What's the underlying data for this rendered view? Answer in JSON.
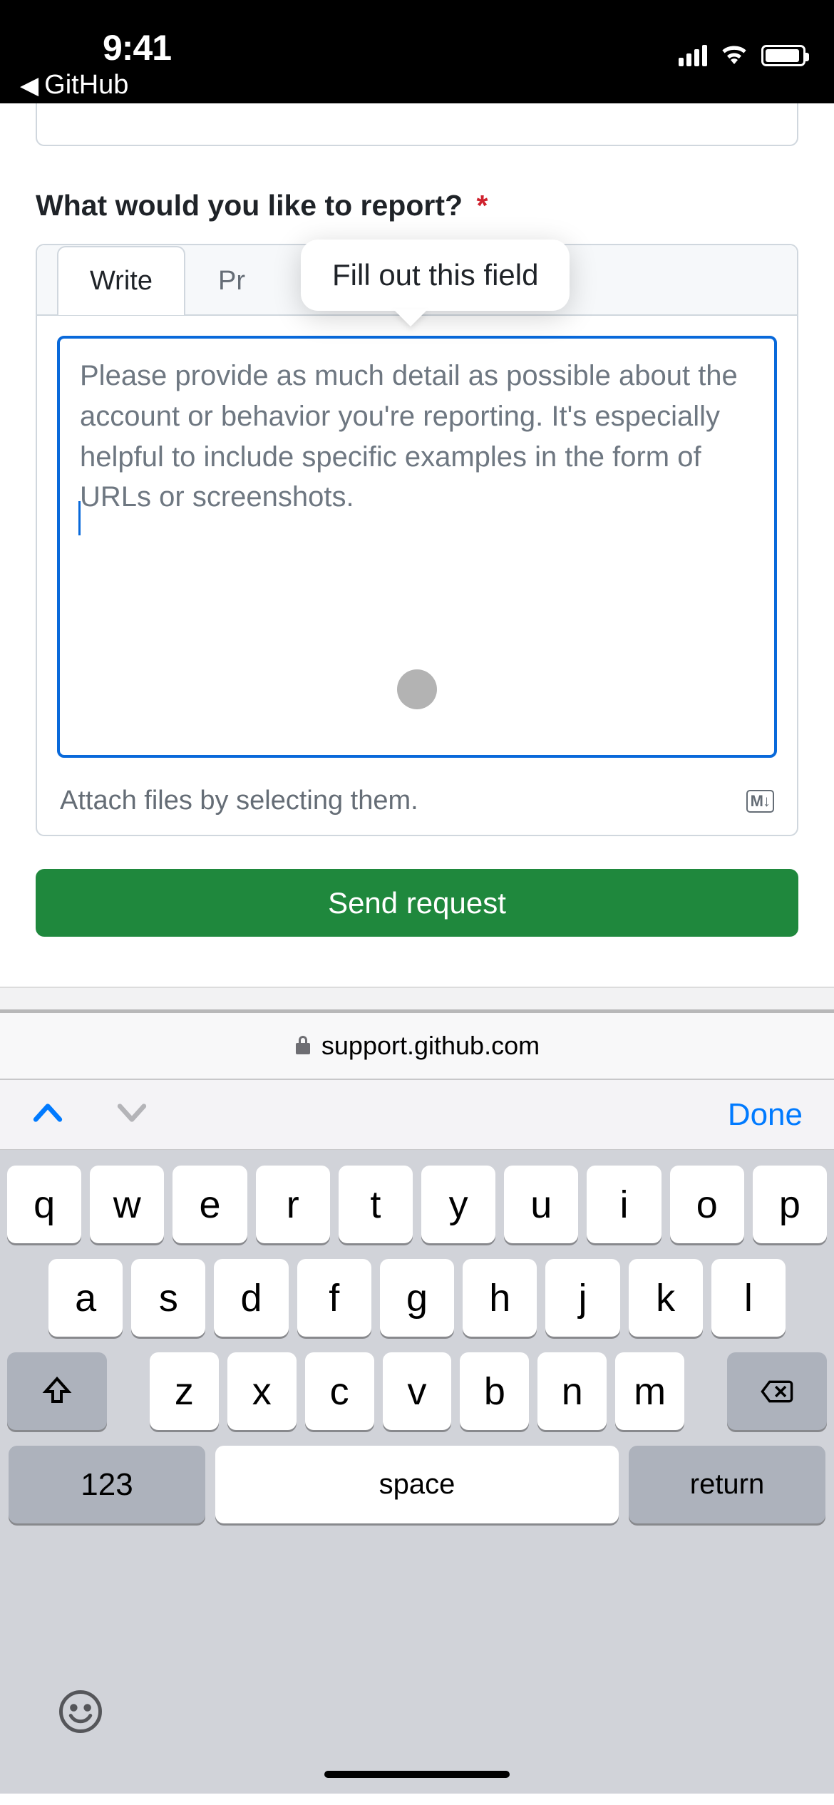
{
  "status_bar": {
    "time": "9:41",
    "back_app": "GitHub"
  },
  "form": {
    "prompt_label": "What would you like to report?",
    "required_mark": "*",
    "tabs": {
      "write": "Write",
      "preview": "Preview",
      "preview_truncated": "Pr"
    },
    "tooltip": "Fill out this field",
    "textarea_value": "",
    "textarea_placeholder": "Please provide as much detail as possible about the account or behavior you're reporting. It's especially helpful to include specific examples in the form of URLs or screenshots.",
    "attach_hint": "Attach files by selecting them.",
    "markdown_badge": "M↓",
    "submit_label": "Send request"
  },
  "urlbar": {
    "domain": "support.github.com"
  },
  "keyboard": {
    "done": "Done",
    "row1": [
      "q",
      "w",
      "e",
      "r",
      "t",
      "y",
      "u",
      "i",
      "o",
      "p"
    ],
    "row2": [
      "a",
      "s",
      "d",
      "f",
      "g",
      "h",
      "j",
      "k",
      "l"
    ],
    "row3": [
      "z",
      "x",
      "c",
      "v",
      "b",
      "n",
      "m"
    ],
    "numbers_key": "123",
    "space_key": "space",
    "return_key": "return"
  }
}
